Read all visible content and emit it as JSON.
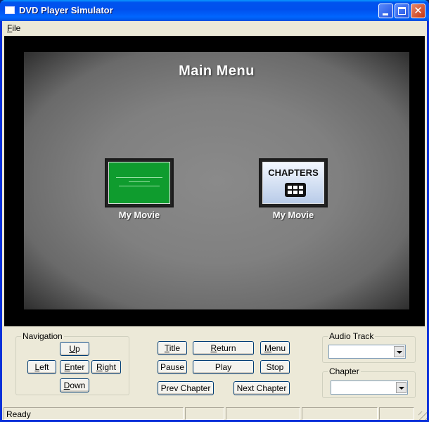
{
  "window": {
    "title": "DVD Player Simulator",
    "frame_color": "#0831d9"
  },
  "menubar": {
    "file": {
      "accel": "F",
      "rest": "ile"
    }
  },
  "dvd_screen": {
    "menu_title": "Main Menu",
    "items": [
      {
        "caption": "My Movie",
        "thumbnail": "movie-thumbnail",
        "thumb_color": "#0f9c2e"
      },
      {
        "caption": "My Movie",
        "thumbnail": "chapters-thumbnail",
        "thumb_text": "CHAPTERS"
      }
    ]
  },
  "navigation": {
    "legend": "Navigation",
    "up": {
      "accel": "U",
      "rest": "p"
    },
    "left": {
      "accel": "L",
      "rest": "eft"
    },
    "enter": {
      "accel": "E",
      "rest": "nter"
    },
    "right": {
      "accel": "R",
      "rest": "ight"
    },
    "down": {
      "accel": "D",
      "rest": "own"
    }
  },
  "transport": {
    "title": {
      "accel": "T",
      "rest": "itle"
    },
    "return": {
      "accel": "R",
      "rest": "eturn"
    },
    "menu": {
      "accel": "M",
      "rest": "enu"
    },
    "pause": "Pause",
    "play": "Play",
    "stop": "Stop",
    "prev_chapter": "Prev Chapter",
    "next_chapter": "Next Chapter"
  },
  "audio_track": {
    "legend": "Audio Track",
    "selected": ""
  },
  "chapter": {
    "legend": "Chapter",
    "selected": ""
  },
  "status": {
    "text": "Ready"
  }
}
